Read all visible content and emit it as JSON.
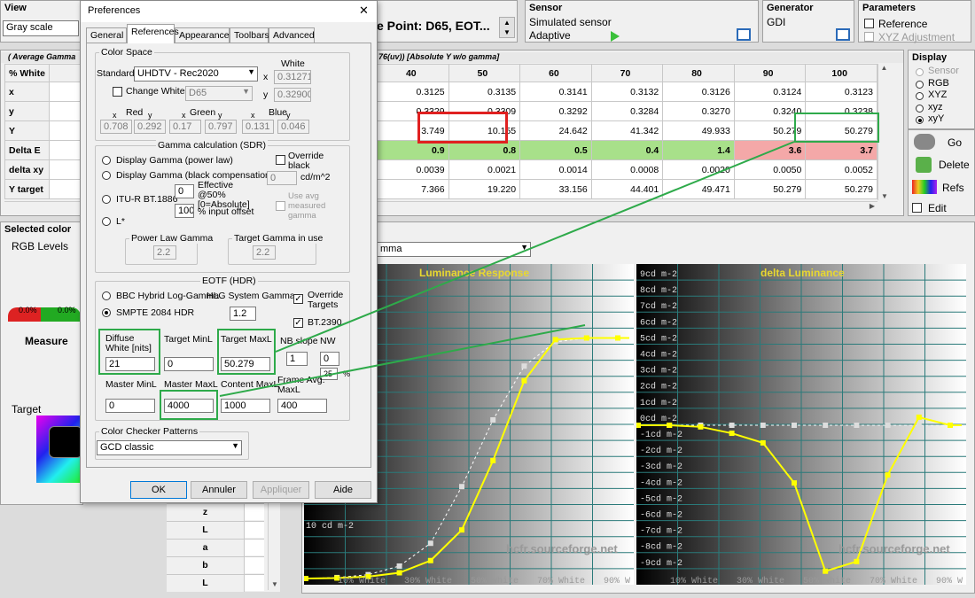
{
  "top": {
    "view": {
      "title": "View",
      "value": "Gray scale"
    },
    "whitepoint": {
      "value": "e Point: D65, EOT..."
    },
    "sensor": {
      "title": "Sensor",
      "name": "Simulated sensor",
      "mode": "Adaptive"
    },
    "generator": {
      "title": "Generator",
      "name": "GDI"
    },
    "parameters": {
      "title": "Parameters",
      "reference": "Reference",
      "xyz_adjust": "XYZ Adjustment"
    }
  },
  "table": {
    "header_left": "( Average Gamma",
    "header_right": "76(uv)) [Absolute Y w/o gamma]",
    "row_labels": [
      "% White",
      "x",
      "y",
      "Y",
      "Delta E",
      "delta xy",
      "Y target"
    ],
    "columns": [
      "40",
      "50",
      "60",
      "70",
      "80",
      "90",
      "100"
    ],
    "rows": [
      [
        "0.3125",
        "0.3135",
        "0.3141",
        "0.3132",
        "0.3126",
        "0.3124",
        "0.3123"
      ],
      [
        "0.3329",
        "0.3309",
        "0.3292",
        "0.3284",
        "0.3270",
        "0.3240",
        "0.3238"
      ],
      [
        "3.749",
        "10.155",
        "24.642",
        "41.342",
        "49.933",
        "50.279",
        "50.279"
      ],
      [
        "0.9",
        "0.8",
        "0.5",
        "0.4",
        "1.4",
        "3.6",
        "3.7"
      ],
      [
        "0.0039",
        "0.0021",
        "0.0014",
        "0.0008",
        "0.0020",
        "0.0050",
        "0.0052"
      ],
      [
        "7.366",
        "19.220",
        "33.156",
        "44.401",
        "49.471",
        "50.279",
        "50.279"
      ]
    ],
    "deltaE_colors": [
      "#a8e08a",
      "#a8e08a",
      "#a8e08a",
      "#a8e08a",
      "#a8e08a",
      "#f4a8a8",
      "#f4a8a8"
    ]
  },
  "display": {
    "title": "Display",
    "options": [
      "Sensor",
      "RGB",
      "XYZ",
      "xyz",
      "xyY"
    ],
    "selected": "xyY",
    "go": "Go",
    "delete": "Delete",
    "refs": "Refs",
    "edit": "Edit"
  },
  "selected_color": {
    "title": "Selected color",
    "rgb_levels": "RGB Levels",
    "pct1": "0.0%",
    "pct2": "0.0%",
    "measure": "Measure",
    "target": "Target"
  },
  "side_labels": [
    "z",
    "L",
    "a",
    "b",
    "L"
  ],
  "graph_dropdown": "mma",
  "charts_text": {
    "left_title": "Luminance Response",
    "right_title": "delta Luminance",
    "watermark": "hcfr.sourceforge.net",
    "left_y_label": "10 cd m-2",
    "left_x_ticks": [
      "10% White",
      "30% White",
      "50% White",
      "70% White",
      "90% W"
    ],
    "right_x_ticks": [
      "10% White",
      "30% White",
      "50% White",
      "70% White",
      "90% W"
    ],
    "right_y_ticks": [
      "9cd m-2",
      "8cd m-2",
      "7cd m-2",
      "6cd m-2",
      "5cd m-2",
      "4cd m-2",
      "3cd m-2",
      "2cd m-2",
      "1cd m-2",
      "0cd m-2",
      "-1cd m-2",
      "-2cd m-2",
      "-3cd m-2",
      "-4cd m-2",
      "-5cd m-2",
      "-6cd m-2",
      "-7cd m-2",
      "-8cd m-2",
      "-9cd m-2"
    ]
  },
  "chart_data": [
    {
      "type": "line",
      "title": "Luminance Response",
      "x": [
        0,
        10,
        20,
        30,
        40,
        50,
        60,
        70,
        80,
        90,
        100
      ],
      "series": [
        {
          "values": [
            0,
            0.1,
            0.4,
            1.2,
            3.749,
            10.155,
            24.642,
            41.342,
            49.933,
            50.279,
            50.279
          ]
        },
        {
          "values": [
            0,
            0.2,
            0.8,
            2.6,
            7.366,
            19.22,
            33.156,
            44.401,
            49.471,
            50.279,
            50.279
          ]
        }
      ]
    },
    {
      "type": "line",
      "title": "delta Luminance",
      "x": [
        0,
        10,
        20,
        30,
        40,
        50,
        60,
        70,
        80,
        90,
        100
      ],
      "series": [
        {
          "values": [
            0,
            0,
            -0.1,
            -0.5,
            -1.1,
            -3.6,
            -9.1,
            -8.5,
            -3.1,
            0.5,
            0
          ]
        },
        {
          "values": [
            0,
            0,
            0,
            0,
            0,
            0,
            0,
            0,
            0,
            0,
            0
          ]
        }
      ],
      "ylim": [
        -9,
        9
      ]
    }
  ],
  "dialog": {
    "title": "Preferences",
    "close": "✕",
    "tabs": [
      "General",
      "References",
      "Appearance",
      "Toolbars",
      "Advanced"
    ],
    "active_tab": "References",
    "color_space": {
      "title": "Color Space",
      "standard_label": "Standard:",
      "standard_value": "UHDTV - Rec2020",
      "white_label": "White",
      "wx_label": "x",
      "wx": "0.312712",
      "wy_label": "y",
      "wy": "0.329008",
      "change_white": "Change White",
      "white_value": "D65",
      "red_label": "Red",
      "green_label": "Green",
      "blue_label": "Blue",
      "x_letter": "x",
      "y_letter": "y",
      "red_x": "0.708",
      "red_y": "0.292",
      "green_x": "0.17",
      "green_y": "0.797",
      "blue_x": "0.131",
      "blue_y": "0.046"
    },
    "gamma": {
      "title": "Gamma calculation (SDR)",
      "opt1": "Display Gamma (power law)",
      "opt2": "Display Gamma (black compensation)",
      "opt3": "ITU-R BT.1886",
      "opt4": "L*",
      "override_black": "Override black",
      "black_value": "0",
      "black_unit": "cd/m^2",
      "effective_value": "0",
      "effective_label": "Effective @50% [0=Absolute]",
      "offset_value": "100",
      "offset_label": "% input offset",
      "use_avg": "Use avg measured gamma",
      "power_law_label": "Power Law Gamma",
      "power_law_value": "2.2",
      "target_gamma_label": "Target Gamma in use",
      "target_gamma_value": "2.2"
    },
    "eotf": {
      "title": "EOTF (HDR)",
      "opt1": "BBC Hybrid Log-Gamma",
      "hlg_label": "HLG System Gamma",
      "hlg_value": "1.2",
      "opt2": "SMPTE 2084 HDR",
      "override_targets": "Override Targets",
      "bt2390": "BT.2390",
      "diffuse_label": "Diffuse White [nits]",
      "diffuse_value": "21",
      "target_min_label": "Target MinL",
      "target_min_value": "0",
      "target_max_label": "Target MaxL",
      "target_max_value": "50.279",
      "nb_slope_label": "NB slope",
      "nb_slope_value": "1",
      "nw_label": "NW",
      "nw_value": "0",
      "nw2_value": "25",
      "pct": "%",
      "master_min_label": "Master MinL",
      "master_min_value": "0",
      "master_max_label": "Master MaxL",
      "master_max_value": "4000",
      "content_max_label": "Content MaxL",
      "content_max_value": "1000",
      "frame_avg_label": "Frame Avg. MaxL",
      "frame_avg_value": "400"
    },
    "checker": {
      "title": "Color Checker Patterns",
      "value": "GCD classic"
    },
    "buttons": {
      "ok": "OK",
      "cancel": "Annuler",
      "apply": "Appliquer",
      "help": "Aide"
    }
  }
}
